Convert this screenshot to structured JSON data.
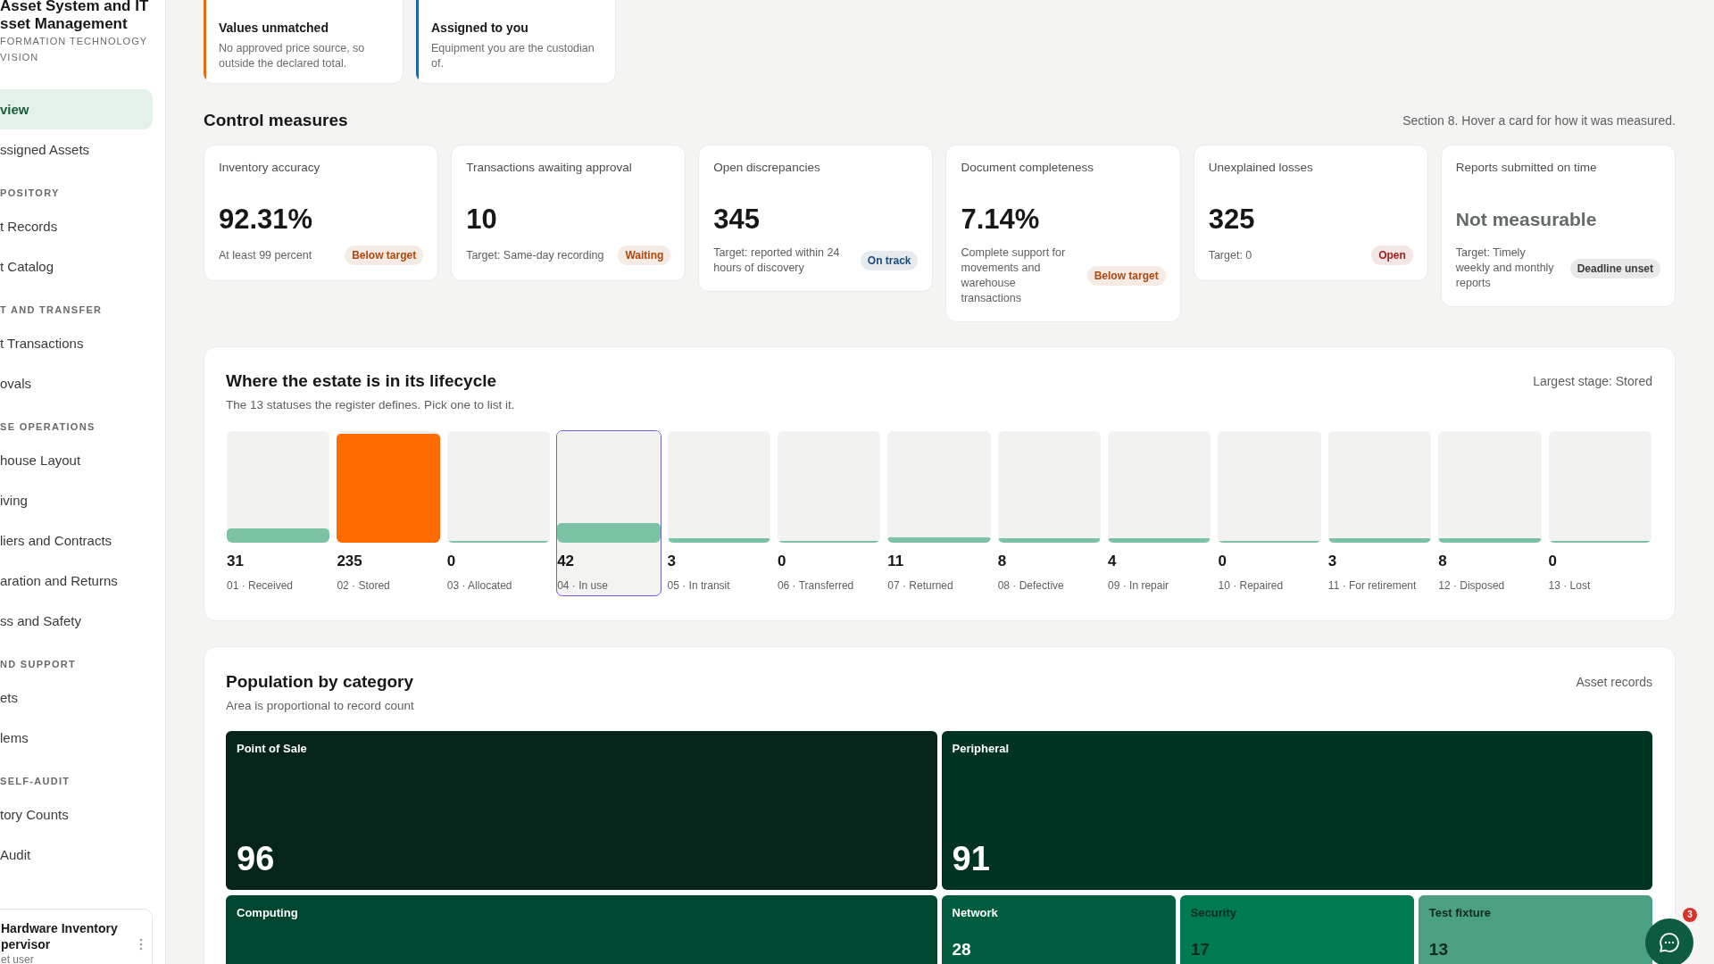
{
  "sidebar": {
    "title_lines": [
      "Asset System and IT",
      "sset Management"
    ],
    "org_lines": [
      "FORMATION TECHNOLOGY",
      "VISION"
    ],
    "sections": [
      {
        "items": [
          {
            "label": "view",
            "selected": true
          },
          {
            "label": "ssigned Assets",
            "selected": false
          }
        ]
      },
      {
        "header": "POSITORY",
        "items": [
          {
            "label": "t Records",
            "selected": false
          },
          {
            "label": "t Catalog",
            "selected": false
          }
        ]
      },
      {
        "header": "T AND TRANSFER",
        "items": [
          {
            "label": "t Transactions",
            "selected": false
          },
          {
            "label": "ovals",
            "selected": false
          }
        ]
      },
      {
        "header": "SE OPERATIONS",
        "items": [
          {
            "label": "house Layout",
            "selected": false
          },
          {
            "label": "iving",
            "selected": false
          },
          {
            "label": "liers and Contracts",
            "selected": false
          },
          {
            "label": "aration and Returns",
            "selected": false
          },
          {
            "label": "ss and Safety",
            "selected": false
          }
        ]
      },
      {
        "header": "ND SUPPORT",
        "items": [
          {
            "label": "ets",
            "selected": false
          },
          {
            "label": "lems",
            "selected": false
          }
        ]
      },
      {
        "header": "SELF-AUDIT",
        "items": [
          {
            "label": "tory Counts",
            "selected": false
          },
          {
            "label": "Audit",
            "selected": false
          }
        ]
      }
    ],
    "user": {
      "name_lines": [
        "Hardware Inventory",
        "pervisor"
      ],
      "role": "et user"
    }
  },
  "summary_cards": [
    {
      "title": "Values unmatched",
      "description": "No approved price source, so outside the declared total.",
      "color": "#e8690f"
    },
    {
      "title": "Assigned to you",
      "description": "Equipment you are the custodian of.",
      "color": "#1f67a3"
    }
  ],
  "control_measures": {
    "title": "Control measures",
    "note": "Section 8. Hover a card for how it was measured.",
    "cards": [
      {
        "label": "Inventory accuracy",
        "value": "92.31%",
        "measurable": true,
        "target": "At least 99 percent",
        "status": {
          "text": "Below target",
          "color": "#b0470c"
        }
      },
      {
        "label": "Transactions awaiting approval",
        "value": "10",
        "measurable": true,
        "target": "Target: Same-day recording",
        "status": {
          "text": "Waiting",
          "color": "#b0470c"
        }
      },
      {
        "label": "Open discrepancies",
        "value": "345",
        "measurable": true,
        "target": "Target: reported within 24 hours of discovery",
        "status": {
          "text": "On track",
          "color": "#1a4d7a"
        }
      },
      {
        "label": "Document completeness",
        "value": "7.14%",
        "measurable": true,
        "target": "Complete support for movements and warehouse transactions",
        "status": {
          "text": "Below target",
          "color": "#b0470c"
        }
      },
      {
        "label": "Unexplained losses",
        "value": "325",
        "measurable": true,
        "target": "Target: 0",
        "status": {
          "text": "Open",
          "color": "#a51d1d"
        }
      },
      {
        "label": "Reports submitted on time",
        "value": "Not measurable",
        "measurable": false,
        "target": "Target: Timely weekly and monthly reports",
        "status": {
          "text": "Deadline unset",
          "color": "#3b3b3b"
        }
      }
    ]
  },
  "lifecycle": {
    "title": "Where the estate is in its lifecycle",
    "subtitle": "The 13 statuses the register defines. Pick one to list it.",
    "note": "Largest stage: Stored",
    "stages": [
      {
        "count": "31",
        "label": "01 · Received",
        "level": 0.132,
        "color": "#7cc3a6",
        "selected": false
      },
      {
        "count": "235",
        "label": "02 · Stored",
        "level": 1,
        "color": "#ff6b00",
        "selected": false
      },
      {
        "count": "0",
        "label": "03 · Allocated",
        "level": 0,
        "color": "#7cc3a6",
        "selected": false
      },
      {
        "count": "42",
        "label": "04 · In use",
        "level": 0.179,
        "color": "#7cc3a6",
        "selected": true
      },
      {
        "count": "3",
        "label": "05 · In transit",
        "level": 0.013,
        "color": "#7cc3a6",
        "selected": false
      },
      {
        "count": "0",
        "label": "06 · Transferred",
        "level": 0,
        "color": "#7cc3a6",
        "selected": false
      },
      {
        "count": "11",
        "label": "07 · Returned",
        "level": 0.047,
        "color": "#7cc3a6",
        "selected": false
      },
      {
        "count": "8",
        "label": "08 · Defective",
        "level": 0.034,
        "color": "#7cc3a6",
        "selected": false
      },
      {
        "count": "4",
        "label": "09 · In repair",
        "level": 0.017,
        "color": "#7cc3a6",
        "selected": false
      },
      {
        "count": "0",
        "label": "10 · Repaired",
        "level": 0,
        "color": "#7cc3a6",
        "selected": false
      },
      {
        "count": "3",
        "label": "11 · For retirement",
        "level": 0.013,
        "color": "#7cc3a6",
        "selected": false
      },
      {
        "count": "8",
        "label": "12 · Disposed",
        "level": 0.034,
        "color": "#7cc3a6",
        "selected": false
      },
      {
        "count": "0",
        "label": "13 · Lost",
        "level": 0,
        "color": "#7cc3a6",
        "selected": false
      }
    ]
  },
  "population": {
    "title": "Population by category",
    "subtitle": "Area is proportional to record count",
    "note": "Asset records",
    "rows": [
      {
        "tiles": [
          {
            "label": "Point of Sale",
            "value": "96",
            "color": "#05241a"
          },
          {
            "label": "Peripheral",
            "value": "91",
            "color": "#003322"
          }
        ]
      },
      {
        "tiles": [
          {
            "label": "Computing",
            "color": "#004630"
          },
          {
            "label": "Network",
            "value": "28",
            "color": "#005d3f"
          },
          {
            "label": "Security",
            "value": "17",
            "color": "#007a50"
          },
          {
            "label": "Test fixture",
            "value": "13",
            "color": "#4aa080"
          }
        ]
      }
    ]
  },
  "chat": {
    "unread": "3"
  }
}
